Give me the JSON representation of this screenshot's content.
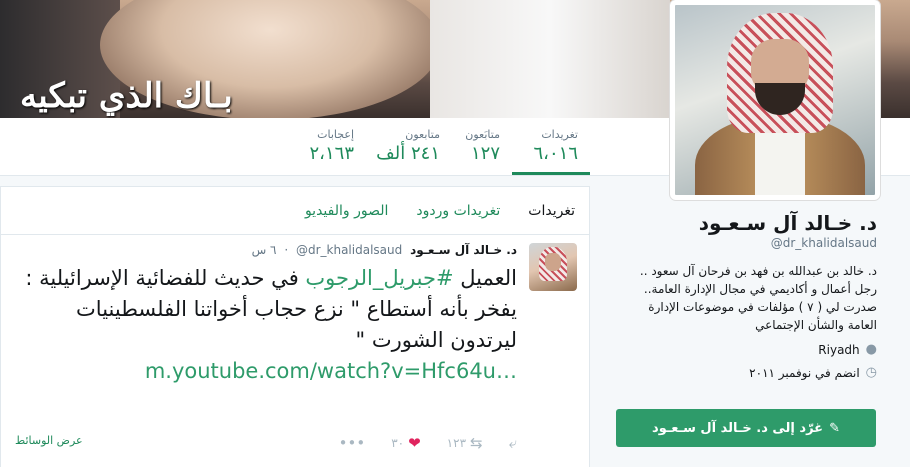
{
  "banner": {
    "slogan": "بـاك الذي تبكيه"
  },
  "stats": [
    {
      "label": "تغريدات",
      "value": "٦،٠١٦",
      "active": true
    },
    {
      "label": "متابَعون",
      "value": "١٢٧"
    },
    {
      "label": "متابعون",
      "value": "٢٤١ ألف"
    },
    {
      "label": "إعجابات",
      "value": "٢،١٦٣"
    }
  ],
  "profile": {
    "name": "د. خـالد آل سـعـود",
    "handle": "@dr_khalidalsaud",
    "bio": "د. خالد بن عبدالله بن فهد بن فرحان آل سعود .. رجل أعمال و أكاديمي في مجال الإدارة العامة.. صدرت لي ( ٧ ) مؤلفات في موضوعات الإدارة العامة والشأن الإجتماعي",
    "location": "Riyadh",
    "joined": "انضم في نوفمبر ٢٠١١",
    "tip_button": "غرّد إلى د. خـالد آل سـعـود"
  },
  "tabs": [
    "تغريدات",
    "تغريدات وردود",
    "الصور والفيديو"
  ],
  "tweet": {
    "name": "د. خـالد آل سـعـود",
    "handle": "@dr_khalidalsaud",
    "time": "٦ س",
    "text_before": "العميل ",
    "hashtag": "#جبريل_الرجوب",
    "text_after": " في حديث للفضائية الإسرائيلية :",
    "line2": "يفخر بأنه أستطاع \" نزع حجاب أخواتنا الفلسطينيات ليرتدون الشورت \"",
    "link": "m.youtube.com/watch?v=Hfc64u…",
    "retweets": "١٢٣",
    "likes": "٣٠",
    "view_media": "عرض الوسائط"
  },
  "colors": {
    "accent": "#2e9b6a",
    "like": "#e0245e"
  }
}
